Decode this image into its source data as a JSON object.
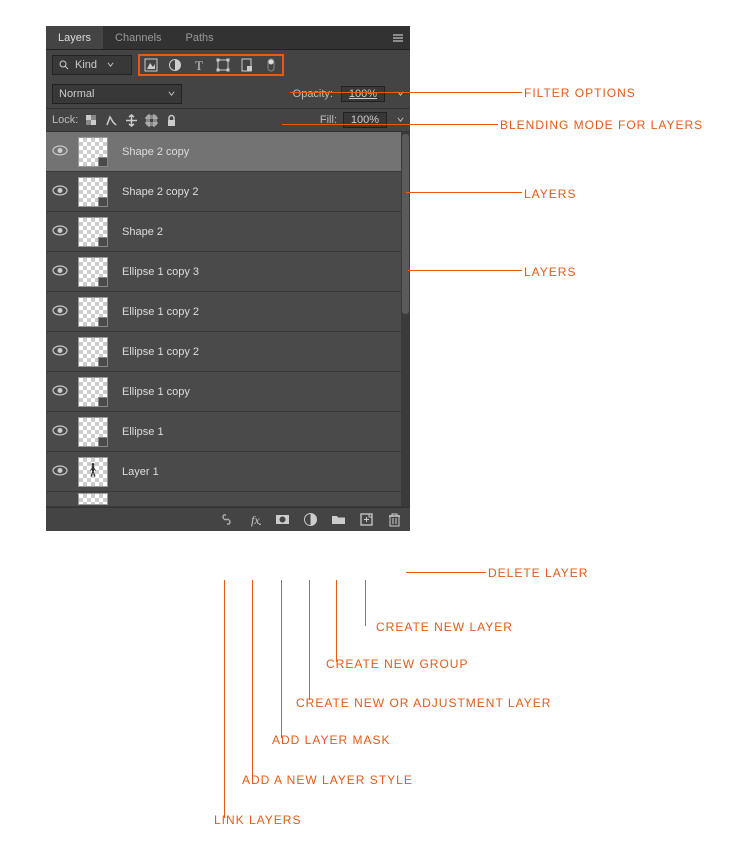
{
  "tabs": {
    "layers": "Layers",
    "channels": "Channels",
    "paths": "Paths"
  },
  "filter": {
    "kind_label": "Kind",
    "search_glyph": "🔍"
  },
  "blend": {
    "mode": "Normal",
    "opacity_label": "Opacity:",
    "opacity_value": "100%"
  },
  "lock": {
    "label": "Lock:",
    "fill_label": "Fill:",
    "fill_value": "100%"
  },
  "layers": [
    {
      "name": "Shape 2 copy",
      "selected": true,
      "person": false
    },
    {
      "name": "Shape 2 copy 2",
      "selected": false,
      "person": false
    },
    {
      "name": "Shape 2",
      "selected": false,
      "person": false
    },
    {
      "name": "Ellipse 1 copy 3",
      "selected": false,
      "person": false
    },
    {
      "name": "Ellipse 1 copy 2",
      "selected": false,
      "person": false
    },
    {
      "name": "Ellipse 1 copy 2",
      "selected": false,
      "person": false
    },
    {
      "name": "Ellipse 1 copy",
      "selected": false,
      "person": false
    },
    {
      "name": "Ellipse 1",
      "selected": false,
      "person": false
    },
    {
      "name": "Layer 1",
      "selected": false,
      "person": true
    }
  ],
  "annotations": {
    "filter_options": "FILTER OPTIONS",
    "blending_mode": "BLENDING MODE FOR LAYERS",
    "layers": "LAYERS",
    "delete_layer": "DELETE LAYER",
    "create_new_layer": "CREATE NEW LAYER",
    "create_new_group": "CREATE NEW GROUP",
    "adjustment_layer": "CREATE NEW OR ADJUSTMENT LAYER",
    "add_layer_mask": "ADD LAYER MASK",
    "add_layer_style": "ADD A NEW LAYER STYLE",
    "link_layers": "LINK LAYERS"
  }
}
